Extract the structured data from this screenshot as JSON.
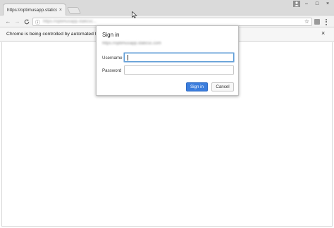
{
  "browser": {
    "tab": {
      "title": "https://optimusapp.staticsc",
      "close_glyph": "×"
    },
    "window": {
      "minimize": "–",
      "maximize": "□",
      "close": "×"
    },
    "toolbar": {
      "back": "←",
      "forward": "→",
      "reload": "C",
      "info_glyph": "ⓘ",
      "url": "https://optimusapp.staticsc...",
      "star": "☆"
    }
  },
  "infobar": {
    "text": "Chrome is being controlled by automated test software.",
    "close_glyph": "×"
  },
  "dialog": {
    "title": "Sign in",
    "origin": "https://optimusapp.staticsc.com",
    "username_label": "Username",
    "password_label": "Password",
    "username_value": "",
    "password_value": "",
    "sign_in_label": "Sign in",
    "cancel_label": "Cancel"
  },
  "colors": {
    "primary_button": "#3b7ddd",
    "focus_ring": "#5b9bd5"
  }
}
